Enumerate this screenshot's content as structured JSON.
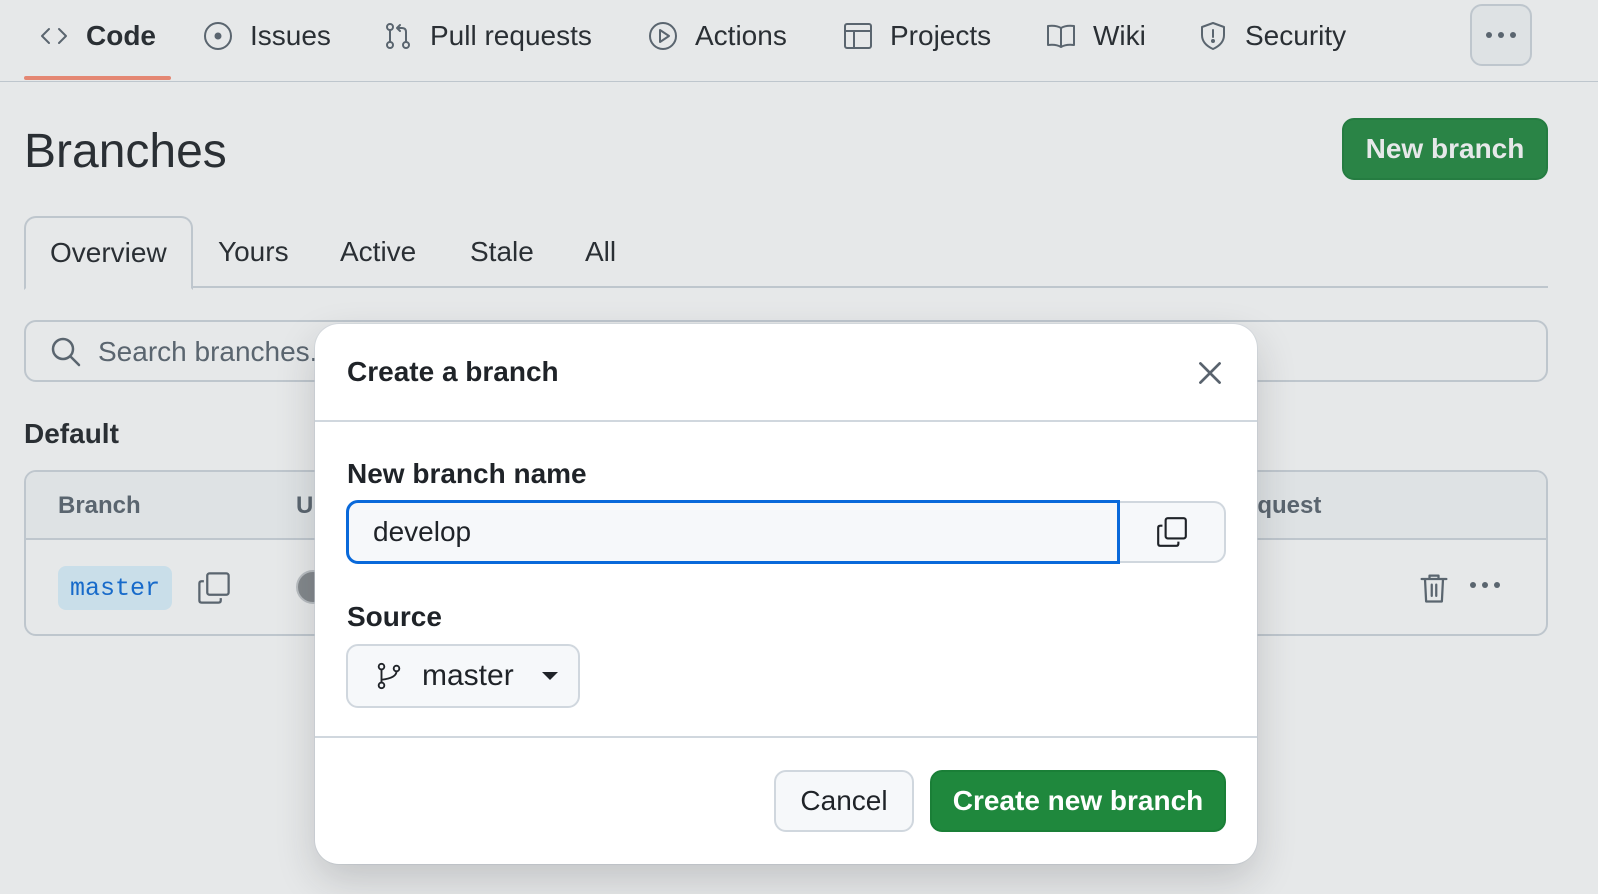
{
  "repo_nav": {
    "items": [
      {
        "label": "Code",
        "icon": "code-icon",
        "selected": true
      },
      {
        "label": "Issues",
        "icon": "issue-icon"
      },
      {
        "label": "Pull requests",
        "icon": "pull-request-icon"
      },
      {
        "label": "Actions",
        "icon": "play-icon"
      },
      {
        "label": "Projects",
        "icon": "table-icon"
      },
      {
        "label": "Wiki",
        "icon": "book-icon"
      },
      {
        "label": "Security",
        "icon": "shield-icon"
      }
    ],
    "more_icon": "kebab-horizontal-icon"
  },
  "page": {
    "title": "Branches",
    "new_branch_label": "New branch"
  },
  "tabs": [
    "Overview",
    "Yours",
    "Active",
    "Stale",
    "All"
  ],
  "active_tab": "Overview",
  "search": {
    "placeholder": "Search branches..."
  },
  "default_section": {
    "heading": "Default",
    "columns": [
      "Branch",
      "U",
      "equest"
    ],
    "rows": [
      {
        "branch": "master"
      }
    ]
  },
  "dialog": {
    "title": "Create a branch",
    "name_label": "New branch name",
    "name_value": "develop",
    "source_label": "Source",
    "source_value": "master",
    "cancel_label": "Cancel",
    "create_label": "Create new branch"
  },
  "colors": {
    "primary_green": "#1f883d",
    "focus_blue": "#0969da",
    "nav_underline": "#fd8c73",
    "branch_pill_bg": "#ddf4ff"
  }
}
